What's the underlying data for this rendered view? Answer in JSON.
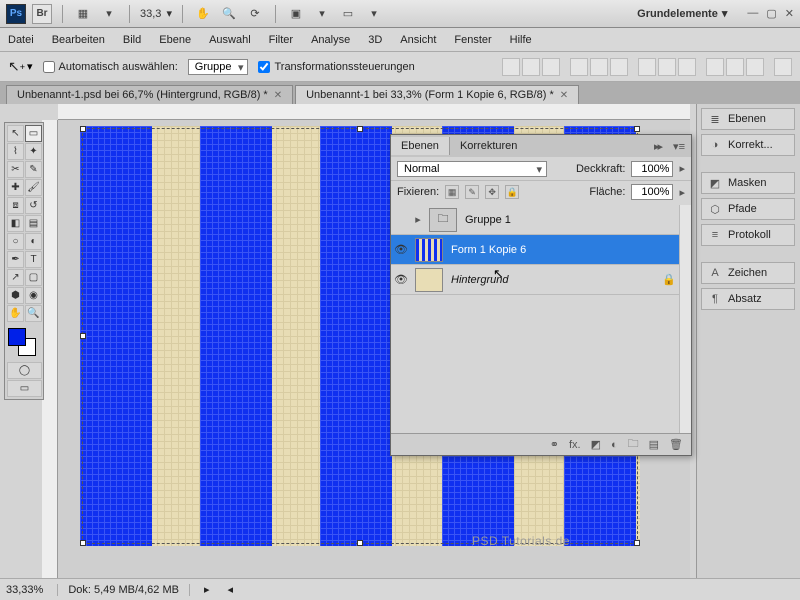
{
  "topbar": {
    "zoom": "33,3",
    "workspace": "Grundelemente"
  },
  "menu": [
    "Datei",
    "Bearbeiten",
    "Bild",
    "Ebene",
    "Auswahl",
    "Filter",
    "Analyse",
    "3D",
    "Ansicht",
    "Fenster",
    "Hilfe"
  ],
  "options": {
    "auto_select": "Automatisch auswählen:",
    "group": "Gruppe",
    "transform_controls": "Transformationssteuerungen"
  },
  "tabs": [
    {
      "label": "Unbenannt-1.psd bei 66,7% (Hintergrund, RGB/8) *",
      "active": false
    },
    {
      "label": "Unbenannt-1 bei 33,3% (Form 1 Kopie 6, RGB/8) *",
      "active": true
    }
  ],
  "dock": {
    "ebenen": "Ebenen",
    "korrekt": "Korrekt...",
    "masken": "Masken",
    "pfade": "Pfade",
    "protokoll": "Protokoll",
    "zeichen": "Zeichen",
    "absatz": "Absatz"
  },
  "layers_panel": {
    "tab_ebenen": "Ebenen",
    "tab_korrekturen": "Korrekturen",
    "blend": "Normal",
    "opacity_label": "Deckkraft:",
    "opacity": "100%",
    "lock_label": "Fixieren:",
    "fill_label": "Fläche:",
    "fill": "100%",
    "layers": [
      {
        "name": "Gruppe 1",
        "type": "group"
      },
      {
        "name": "Form 1 Kopie 6",
        "type": "shape",
        "selected": true
      },
      {
        "name": "Hintergrund",
        "type": "bg",
        "locked": true
      }
    ]
  },
  "status": {
    "zoom": "33,33%",
    "doc": "Dok: 5,49 MB/4,62 MB"
  },
  "colors": {
    "foreground": "#0020e8",
    "background": "#ffffff",
    "stripe": "#1030f0",
    "canvas_bg": "#e8ddb5"
  },
  "watermark": "PSD Tutorials.de"
}
